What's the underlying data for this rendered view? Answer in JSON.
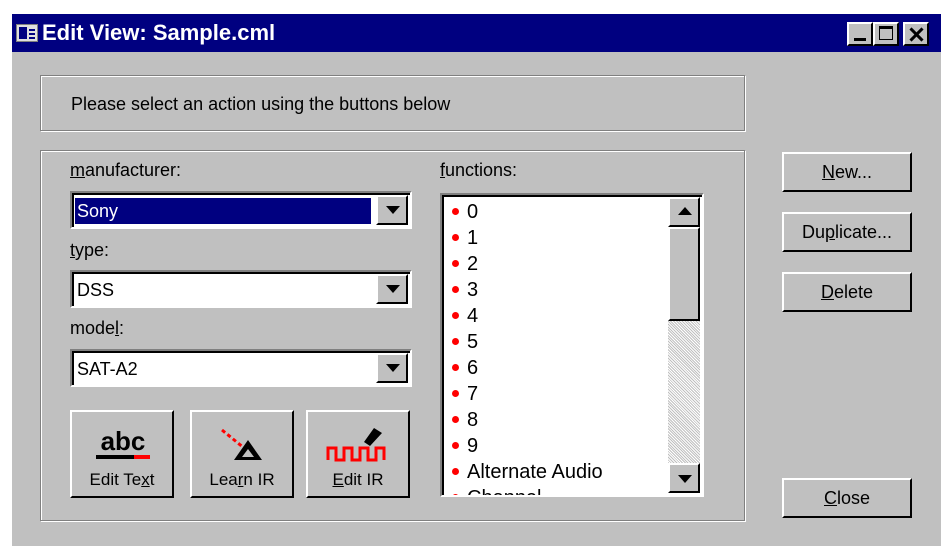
{
  "window": {
    "title": "Edit View: Sample.cml",
    "controls": [
      "minimize",
      "maximize",
      "close"
    ]
  },
  "instruction": "Please select an action using the buttons below",
  "fields": {
    "manufacturer": {
      "label_u": "m",
      "label_rest": "anufacturer:",
      "value": "Sony"
    },
    "type": {
      "label_u": "t",
      "label_rest": "ype:",
      "value": "DSS"
    },
    "model": {
      "label_pre": "mode",
      "label_u": "l",
      "label_rest": ":",
      "value": "SAT-A2"
    }
  },
  "functions": {
    "label_u": "f",
    "label_rest": "unctions:",
    "items": [
      "0",
      "1",
      "2",
      "3",
      "4",
      "5",
      "6",
      "7",
      "8",
      "9",
      "Alternate Audio",
      "Channel"
    ]
  },
  "tool_buttons": [
    {
      "icon": "abc-icon",
      "cap_pre": "Edit Te",
      "cap_u": "x",
      "cap_post": "t"
    },
    {
      "icon": "learn-ir-icon",
      "cap_pre": "Lea",
      "cap_u": "r",
      "cap_post": "n IR"
    },
    {
      "icon": "edit-ir-icon",
      "cap_pre": "",
      "cap_u": "E",
      "cap_post": "dit IR"
    }
  ],
  "side_buttons": {
    "new": {
      "pre": "",
      "u": "N",
      "post": "ew..."
    },
    "duplicate": {
      "pre": "Du",
      "u": "p",
      "post": "licate..."
    },
    "delete": {
      "pre": "",
      "u": "D",
      "post": "elete"
    },
    "close": {
      "pre": "",
      "u": "C",
      "post": "lose"
    }
  },
  "colors": {
    "titlebar": "#000080",
    "face": "#c0c0c0",
    "bullet": "#ff0000",
    "selection": "#000080"
  }
}
